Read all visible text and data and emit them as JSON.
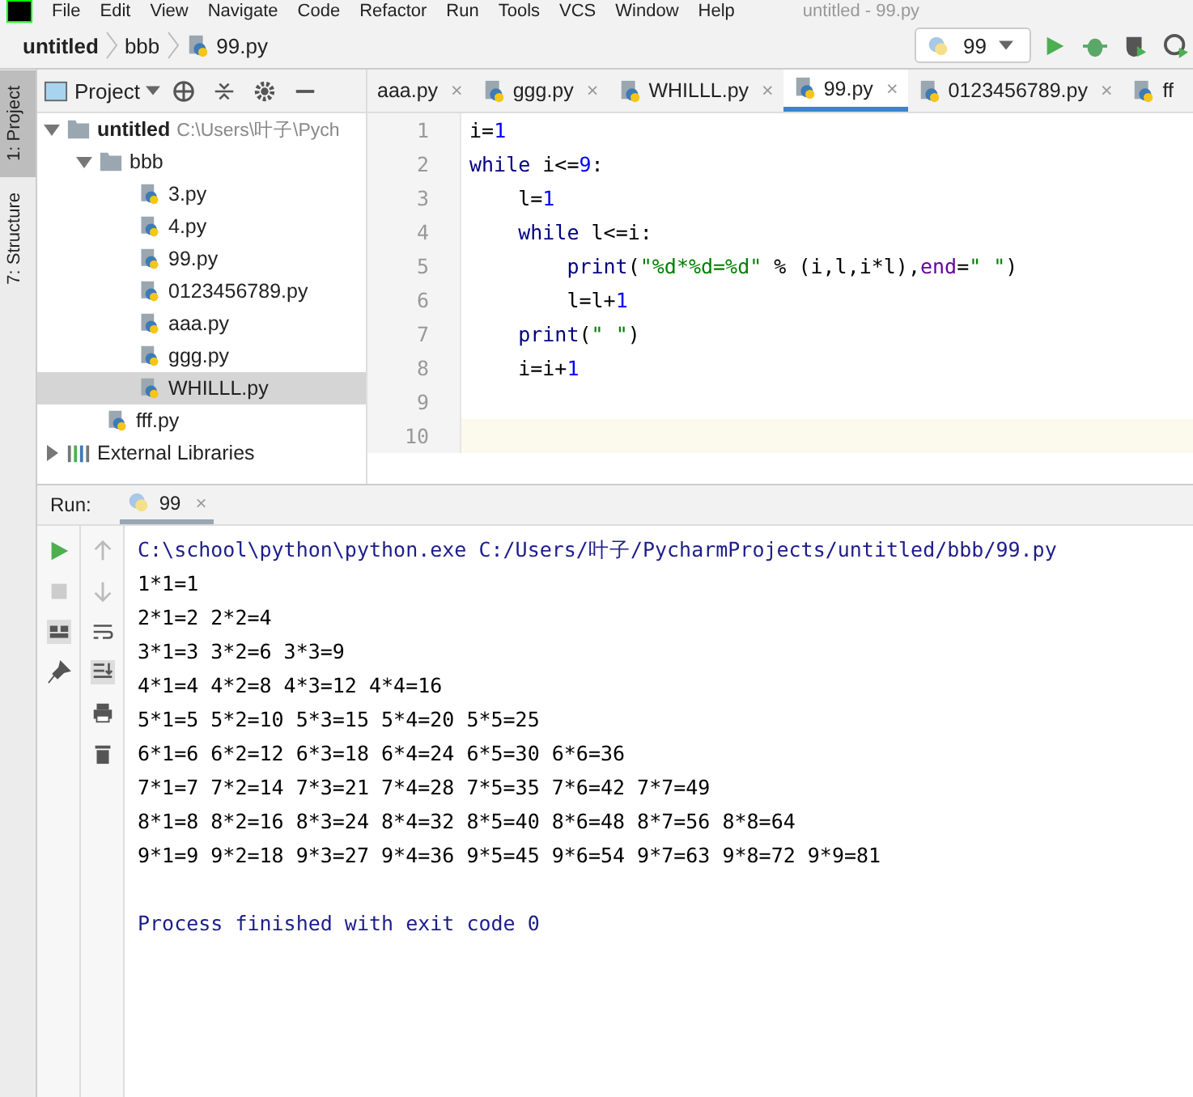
{
  "menu": [
    "File",
    "Edit",
    "View",
    "Navigate",
    "Code",
    "Refactor",
    "Run",
    "Tools",
    "VCS",
    "Window",
    "Help"
  ],
  "window": {
    "title": "untitled - 99.py"
  },
  "breadcrumbs": [
    "untitled",
    "bbb",
    "99.py"
  ],
  "run_config": {
    "label": "99"
  },
  "side_tabs": [
    {
      "label": "1: Project",
      "selected": true
    },
    {
      "label": "7: Structure",
      "selected": false
    }
  ],
  "project": {
    "title": "Project",
    "tree": [
      {
        "label": "untitled",
        "kind": "folder",
        "path": "C:\\Users\\叶子\\Pych",
        "expanded": true,
        "selected": false,
        "children": [
          {
            "label": "bbb",
            "kind": "folder",
            "expanded": true,
            "selected": false,
            "children": [
              {
                "label": "3.py",
                "kind": "file",
                "selected": false
              },
              {
                "label": "4.py",
                "kind": "file",
                "selected": false
              },
              {
                "label": "99.py",
                "kind": "file",
                "selected": false
              },
              {
                "label": "0123456789.py",
                "kind": "file",
                "selected": false
              },
              {
                "label": "aaa.py",
                "kind": "file",
                "selected": false
              },
              {
                "label": "ggg.py",
                "kind": "file",
                "selected": false
              },
              {
                "label": "WHILLL.py",
                "kind": "file",
                "selected": true
              }
            ]
          },
          {
            "label": "fff.py",
            "kind": "file",
            "selected": false
          }
        ]
      },
      {
        "label": "External Libraries",
        "kind": "library",
        "expanded": false,
        "selected": false
      }
    ]
  },
  "editor_tabs": [
    {
      "label": "aaa.py",
      "selected": false,
      "icon": false,
      "close": "×"
    },
    {
      "label": "ggg.py",
      "selected": false,
      "icon": true,
      "close": "×"
    },
    {
      "label": "WHILLL.py",
      "selected": false,
      "icon": true,
      "close": "×"
    },
    {
      "label": "99.py",
      "selected": true,
      "icon": true,
      "close": "×"
    },
    {
      "label": "0123456789.py",
      "selected": false,
      "icon": true,
      "close": "×"
    },
    {
      "label": "ff",
      "selected": false,
      "icon": true
    }
  ],
  "code": [
    {
      "number": "1",
      "tokens": [
        {
          "kind": "plain",
          "text": "i="
        },
        {
          "kind": "number",
          "text": "1"
        }
      ]
    },
    {
      "number": "2",
      "tokens": [
        {
          "kind": "keyword",
          "text": "while "
        },
        {
          "kind": "plain",
          "text": "i<="
        },
        {
          "kind": "number",
          "text": "9"
        },
        {
          "kind": "plain",
          "text": ":"
        }
      ]
    },
    {
      "number": "3",
      "tokens": [
        {
          "kind": "plain",
          "text": "    l="
        },
        {
          "kind": "number",
          "text": "1"
        }
      ]
    },
    {
      "number": "4",
      "tokens": [
        {
          "kind": "keyword",
          "text": "    while "
        },
        {
          "kind": "plain",
          "text": "l<=i:"
        }
      ]
    },
    {
      "number": "5",
      "tokens": [
        {
          "kind": "keyword",
          "text": "        print"
        },
        {
          "kind": "plain",
          "text": "("
        },
        {
          "kind": "string",
          "text": "\"%d*%d=%d\""
        },
        {
          "kind": "plain",
          "text": " % (i,l,i*l),"
        },
        {
          "kind": "param",
          "text": "end"
        },
        {
          "kind": "plain",
          "text": "="
        },
        {
          "kind": "string",
          "text": "\" \""
        },
        {
          "kind": "plain",
          "text": ")"
        }
      ]
    },
    {
      "number": "6",
      "tokens": [
        {
          "kind": "plain",
          "text": "        l=l+"
        },
        {
          "kind": "number",
          "text": "1"
        }
      ]
    },
    {
      "number": "7",
      "tokens": [
        {
          "kind": "keyword",
          "text": "    print"
        },
        {
          "kind": "plain",
          "text": "("
        },
        {
          "kind": "string",
          "text": "\" \""
        },
        {
          "kind": "plain",
          "text": ")"
        }
      ]
    },
    {
      "number": "8",
      "tokens": [
        {
          "kind": "plain",
          "text": "    i=i+"
        },
        {
          "kind": "number",
          "text": "1"
        }
      ]
    },
    {
      "number": "9"
    },
    {
      "number": "10"
    }
  ],
  "run": {
    "label": "Run:",
    "tab": "99",
    "tab_close": "×",
    "console": [
      {
        "kind": "command",
        "text": "C:\\school\\python\\python.exe C:/Users/叶子/PycharmProjects/untitled/bbb/99.py"
      },
      {
        "kind": "output",
        "text": "1*1=1"
      },
      {
        "kind": "output",
        "text": "2*1=2 2*2=4"
      },
      {
        "kind": "output",
        "text": "3*1=3 3*2=6 3*3=9"
      },
      {
        "kind": "output",
        "text": "4*1=4 4*2=8 4*3=12 4*4=16"
      },
      {
        "kind": "output",
        "text": "5*1=5 5*2=10 5*3=15 5*4=20 5*5=25"
      },
      {
        "kind": "output",
        "text": "6*1=6 6*2=12 6*3=18 6*4=24 6*5=30 6*6=36"
      },
      {
        "kind": "output",
        "text": "7*1=7 7*2=14 7*3=21 7*4=28 7*5=35 7*6=42 7*7=49"
      },
      {
        "kind": "output",
        "text": "8*1=8 8*2=16 8*3=24 8*4=32 8*5=40 8*6=48 8*7=56 8*8=64"
      },
      {
        "kind": "output",
        "text": "9*1=9 9*2=18 9*3=27 9*4=36 9*5=45 9*6=54 9*7=63 9*8=72 9*9=81"
      },
      {
        "kind": "blank"
      },
      {
        "kind": "command",
        "text": "Process finished with exit code 0"
      }
    ]
  }
}
